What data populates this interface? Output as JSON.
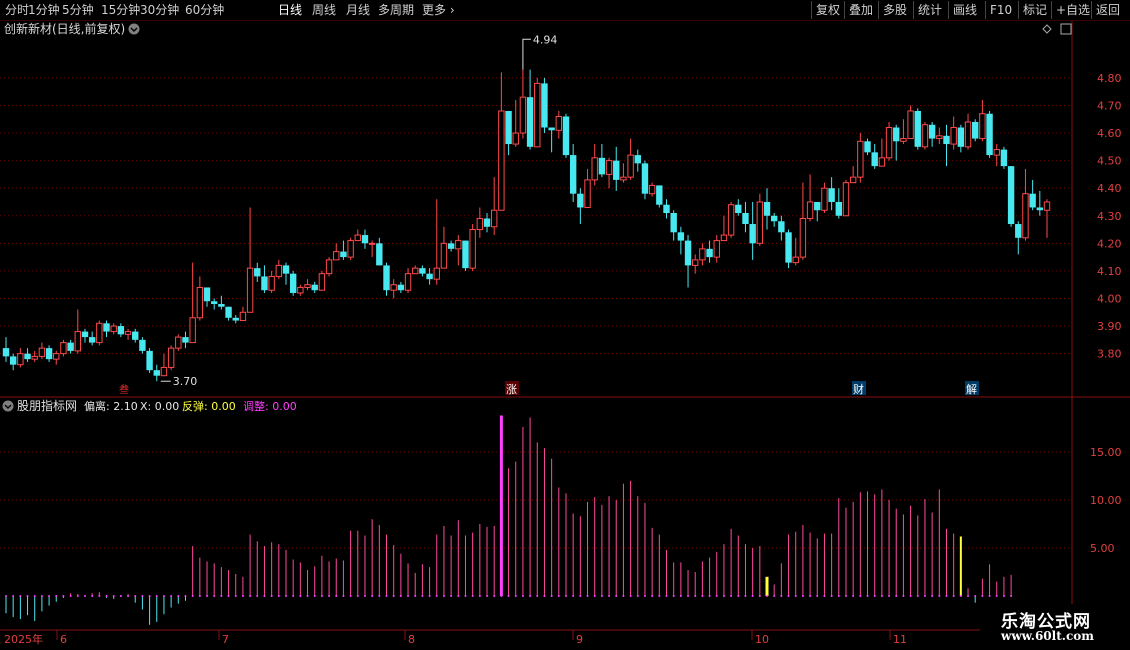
{
  "toolbar": {
    "left": [
      "分时",
      "1分钟",
      "5分钟",
      "15分钟",
      "30分钟",
      "60分钟",
      "日线",
      "周线",
      "月线",
      "多周期",
      "更多"
    ],
    "active": "日线",
    "right": [
      "复权",
      "叠加",
      "多股",
      "统计",
      "画线",
      "F10",
      "标记",
      "+自选",
      "返回"
    ]
  },
  "main": {
    "title": "创新新材(日线,前复权)",
    "price_ticks": [
      "4.80",
      "4.70",
      "4.60",
      "4.50",
      "4.40",
      "4.30",
      "4.20",
      "4.10",
      "4.00",
      "3.90",
      "3.80"
    ],
    "high_label": "4.94",
    "low_label": "3.70",
    "markers": [
      {
        "text": "叁",
        "color": "#e03030"
      },
      {
        "text": "涨",
        "color": "#e03030"
      },
      {
        "text": "财",
        "color": "#4aa8ff"
      },
      {
        "text": "解",
        "color": "#4aa8ff"
      }
    ]
  },
  "indicator": {
    "name": "股朋指标网",
    "items": [
      {
        "label": "偏离: 2.10",
        "color": "#e6e6e6"
      },
      {
        "label": "X: 0.00",
        "color": "#e6e6e6"
      },
      {
        "label": "反弹: 0.00",
        "color": "#ffff40"
      },
      {
        "label": "调整: 0.00",
        "color": "#ff40ff"
      }
    ],
    "ticks": [
      "15.00",
      "10.00",
      "5.00"
    ]
  },
  "xaxis": {
    "labels": [
      "2025年",
      "6",
      "7",
      "8",
      "9",
      "10",
      "11"
    ]
  },
  "watermark": {
    "title": "乐淘公式网",
    "url": "www.60lt.com"
  },
  "chart_data": {
    "type": "candlestick",
    "price_axis": {
      "min": 3.65,
      "max": 4.97
    },
    "candles": [
      [
        3.82,
        3.79,
        3.86,
        3.77
      ],
      [
        3.79,
        3.76,
        3.8,
        3.74
      ],
      [
        3.76,
        3.8,
        3.82,
        3.75
      ],
      [
        3.8,
        3.78,
        3.82,
        3.77
      ],
      [
        3.78,
        3.79,
        3.81,
        3.77
      ],
      [
        3.79,
        3.82,
        3.84,
        3.78
      ],
      [
        3.82,
        3.78,
        3.83,
        3.77
      ],
      [
        3.78,
        3.8,
        3.81,
        3.76
      ],
      [
        3.8,
        3.84,
        3.85,
        3.79
      ],
      [
        3.84,
        3.81,
        3.85,
        3.8
      ],
      [
        3.81,
        3.88,
        3.96,
        3.8
      ],
      [
        3.88,
        3.86,
        3.89,
        3.84
      ],
      [
        3.86,
        3.84,
        3.88,
        3.83
      ],
      [
        3.84,
        3.91,
        3.92,
        3.83
      ],
      [
        3.91,
        3.88,
        3.92,
        3.86
      ],
      [
        3.88,
        3.9,
        3.91,
        3.87
      ],
      [
        3.9,
        3.87,
        3.91,
        3.86
      ],
      [
        3.87,
        3.88,
        3.89,
        3.85
      ],
      [
        3.88,
        3.85,
        3.89,
        3.84
      ],
      [
        3.85,
        3.81,
        3.86,
        3.8
      ],
      [
        3.81,
        3.74,
        3.82,
        3.73
      ],
      [
        3.74,
        3.72,
        3.76,
        3.7
      ],
      [
        3.72,
        3.75,
        3.8,
        3.72
      ],
      [
        3.75,
        3.82,
        3.83,
        3.74
      ],
      [
        3.82,
        3.86,
        3.87,
        3.81
      ],
      [
        3.86,
        3.84,
        3.88,
        3.82
      ],
      [
        3.84,
        3.93,
        4.13,
        3.93
      ],
      [
        3.93,
        4.04,
        4.08,
        3.92
      ],
      [
        4.04,
        3.99,
        4.04,
        3.97
      ],
      [
        3.99,
        3.98,
        4.0,
        3.96
      ],
      [
        3.98,
        3.97,
        4.01,
        3.96
      ],
      [
        3.97,
        3.93,
        3.97,
        3.92
      ],
      [
        3.93,
        3.92,
        3.94,
        3.91
      ],
      [
        3.92,
        3.95,
        3.97,
        3.92
      ],
      [
        3.95,
        4.11,
        4.33,
        3.95
      ],
      [
        4.11,
        4.08,
        4.13,
        4.06
      ],
      [
        4.08,
        4.03,
        4.12,
        4.02
      ],
      [
        4.03,
        4.08,
        4.1,
        4.02
      ],
      [
        4.08,
        4.12,
        4.14,
        4.07
      ],
      [
        4.12,
        4.09,
        4.13,
        4.05
      ],
      [
        4.09,
        4.02,
        4.1,
        4.01
      ],
      [
        4.02,
        4.04,
        4.05,
        4.01
      ],
      [
        4.04,
        4.05,
        4.07,
        4.03
      ],
      [
        4.05,
        4.03,
        4.06,
        4.02
      ],
      [
        4.03,
        4.09,
        4.1,
        4.03
      ],
      [
        4.09,
        4.14,
        4.15,
        4.08
      ],
      [
        4.14,
        4.17,
        4.2,
        4.14
      ],
      [
        4.17,
        4.15,
        4.21,
        4.14
      ],
      [
        4.15,
        4.21,
        4.22,
        4.14
      ],
      [
        4.21,
        4.23,
        4.25,
        4.21
      ],
      [
        4.23,
        4.2,
        4.25,
        4.18
      ],
      [
        4.2,
        4.2,
        4.21,
        4.15
      ],
      [
        4.2,
        4.12,
        4.22,
        4.12
      ],
      [
        4.12,
        4.03,
        4.13,
        4.01
      ],
      [
        4.03,
        4.05,
        4.07,
        4.0
      ],
      [
        4.05,
        4.03,
        4.06,
        4.02
      ],
      [
        4.03,
        4.09,
        4.11,
        4.02
      ],
      [
        4.09,
        4.11,
        4.12,
        4.09
      ],
      [
        4.11,
        4.09,
        4.12,
        4.08
      ],
      [
        4.09,
        4.07,
        4.11,
        4.05
      ],
      [
        4.07,
        4.11,
        4.36,
        4.05
      ],
      [
        4.11,
        4.2,
        4.26,
        4.19
      ],
      [
        4.2,
        4.18,
        4.21,
        4.17
      ],
      [
        4.18,
        4.21,
        4.23,
        4.12
      ],
      [
        4.21,
        4.11,
        4.21,
        4.1
      ],
      [
        4.11,
        4.25,
        4.27,
        4.1
      ],
      [
        4.25,
        4.29,
        4.33,
        4.22
      ],
      [
        4.29,
        4.26,
        4.31,
        4.24
      ],
      [
        4.26,
        4.32,
        4.44,
        4.23
      ],
      [
        4.32,
        4.68,
        4.82,
        4.32
      ],
      [
        4.68,
        4.56,
        4.68,
        4.52
      ],
      [
        4.56,
        4.6,
        4.72,
        4.55
      ],
      [
        4.6,
        4.73,
        4.83,
        4.58
      ],
      [
        4.73,
        4.55,
        4.83,
        4.54
      ],
      [
        4.55,
        4.78,
        4.8,
        4.55
      ],
      [
        4.78,
        4.62,
        4.8,
        4.6
      ],
      [
        4.62,
        4.61,
        4.62,
        4.53
      ],
      [
        4.61,
        4.66,
        4.68,
        4.58
      ],
      [
        4.66,
        4.52,
        4.67,
        4.51
      ],
      [
        4.52,
        4.38,
        4.56,
        4.35
      ],
      [
        4.38,
        4.33,
        4.4,
        4.27
      ],
      [
        4.33,
        4.43,
        4.47,
        4.33
      ],
      [
        4.43,
        4.51,
        4.56,
        4.41
      ],
      [
        4.51,
        4.45,
        4.56,
        4.44
      ],
      [
        4.45,
        4.5,
        4.51,
        4.4
      ],
      [
        4.5,
        4.43,
        4.55,
        4.39
      ],
      [
        4.43,
        4.44,
        4.49,
        4.42
      ],
      [
        4.44,
        4.52,
        4.58,
        4.43
      ],
      [
        4.52,
        4.49,
        4.54,
        4.46
      ],
      [
        4.49,
        4.38,
        4.5,
        4.36
      ],
      [
        4.38,
        4.41,
        4.42,
        4.37
      ],
      [
        4.41,
        4.34,
        4.41,
        4.33
      ],
      [
        4.34,
        4.31,
        4.36,
        4.29
      ],
      [
        4.31,
        4.24,
        4.32,
        4.21
      ],
      [
        4.24,
        4.21,
        4.26,
        4.16
      ],
      [
        4.21,
        4.12,
        4.23,
        4.04
      ],
      [
        4.12,
        4.14,
        4.16,
        4.09
      ],
      [
        4.14,
        4.18,
        4.2,
        4.12
      ],
      [
        4.18,
        4.15,
        4.21,
        4.13
      ],
      [
        4.15,
        4.21,
        4.23,
        4.13
      ],
      [
        4.21,
        4.23,
        4.3,
        4.22
      ],
      [
        4.23,
        4.34,
        4.35,
        4.22
      ],
      [
        4.34,
        4.31,
        4.36,
        4.3
      ],
      [
        4.31,
        4.27,
        4.35,
        4.24
      ],
      [
        4.27,
        4.2,
        4.35,
        4.14
      ],
      [
        4.2,
        4.35,
        4.38,
        4.19
      ],
      [
        4.35,
        4.3,
        4.4,
        4.25
      ],
      [
        4.3,
        4.28,
        4.31,
        4.26
      ],
      [
        4.28,
        4.24,
        4.3,
        4.21
      ],
      [
        4.24,
        4.13,
        4.25,
        4.11
      ],
      [
        4.13,
        4.15,
        4.22,
        4.12
      ],
      [
        4.15,
        4.29,
        4.42,
        4.14
      ],
      [
        4.29,
        4.35,
        4.45,
        4.28
      ],
      [
        4.35,
        4.32,
        4.35,
        4.28
      ],
      [
        4.32,
        4.4,
        4.42,
        4.31
      ],
      [
        4.4,
        4.35,
        4.44,
        4.32
      ],
      [
        4.35,
        4.3,
        4.4,
        4.29
      ],
      [
        4.3,
        4.42,
        4.43,
        4.35
      ],
      [
        4.42,
        4.44,
        4.48,
        4.43
      ],
      [
        4.44,
        4.57,
        4.6,
        4.42
      ],
      [
        4.57,
        4.53,
        4.58,
        4.52
      ],
      [
        4.53,
        4.48,
        4.56,
        4.47
      ],
      [
        4.48,
        4.51,
        4.58,
        4.48
      ],
      [
        4.51,
        4.62,
        4.64,
        4.5
      ],
      [
        4.62,
        4.57,
        4.63,
        4.5
      ],
      [
        4.57,
        4.58,
        4.65,
        4.56
      ],
      [
        4.58,
        4.68,
        4.7,
        4.58
      ],
      [
        4.68,
        4.55,
        4.69,
        4.54
      ],
      [
        4.55,
        4.63,
        4.64,
        4.54
      ],
      [
        4.63,
        4.58,
        4.64,
        4.55
      ],
      [
        4.58,
        4.59,
        4.62,
        4.56
      ],
      [
        4.59,
        4.56,
        4.63,
        4.48
      ],
      [
        4.56,
        4.62,
        4.66,
        4.54
      ],
      [
        4.62,
        4.55,
        4.63,
        4.53
      ],
      [
        4.55,
        4.64,
        4.67,
        4.54
      ],
      [
        4.64,
        4.58,
        4.65,
        4.57
      ],
      [
        4.58,
        4.67,
        4.72,
        4.57
      ],
      [
        4.67,
        4.52,
        4.68,
        4.51
      ],
      [
        4.52,
        4.54,
        4.56,
        4.48
      ],
      [
        4.54,
        4.48,
        4.55,
        4.47
      ],
      [
        4.48,
        4.27,
        4.48,
        4.26
      ],
      [
        4.27,
        4.22,
        4.28,
        4.16
      ],
      [
        4.22,
        4.38,
        4.47,
        4.21
      ],
      [
        4.38,
        4.33,
        4.43,
        4.32
      ],
      [
        4.33,
        4.32,
        4.39,
        4.3
      ],
      [
        4.32,
        4.35,
        4.36,
        4.22
      ]
    ],
    "indicator_axis": {
      "min": -3,
      "max": 19
    },
    "indicator_values": [
      -1.8,
      -2.2,
      -2.4,
      -2.0,
      -2.6,
      -1.6,
      -1.0,
      -0.6,
      -0.2,
      0.3,
      0.2,
      -0.1,
      0.3,
      0.4,
      -0.2,
      -0.3,
      -0.1,
      0.2,
      -0.7,
      -1.4,
      -3.0,
      -2.7,
      -1.9,
      -1.2,
      -0.8,
      -0.5,
      5.2,
      4.0,
      3.6,
      3.4,
      3.0,
      2.7,
      2.3,
      2.0,
      6.4,
      5.7,
      5.2,
      5.6,
      5.4,
      4.8,
      3.8,
      3.5,
      2.7,
      3.1,
      4.2,
      3.6,
      3.9,
      3.7,
      6.8,
      6.8,
      6.3,
      8.0,
      7.4,
      6.4,
      5.3,
      4.4,
      3.4,
      2.4,
      3.3,
      3.0,
      6.4,
      7.3,
      6.3,
      7.9,
      6.3,
      6.6,
      7.5,
      7.2,
      7.3,
      18.8,
      13.3,
      14.0,
      17.6,
      18.6,
      16.0,
      15.4,
      14.3,
      11.3,
      10.7,
      8.6,
      8.3,
      9.8,
      10.3,
      9.5,
      10.4,
      10.0,
      11.7,
      12.0,
      10.4,
      9.7,
      7.1,
      6.4,
      4.8,
      3.5,
      3.5,
      2.7,
      2.5,
      3.6,
      4.0,
      4.6,
      5.4,
      7.0,
      6.3,
      5.4,
      5.0,
      5.2,
      2.0,
      1.2,
      3.4,
      6.4,
      6.7,
      7.4,
      6.6,
      6.0,
      6.5,
      6.5,
      10.2,
      9.2,
      9.8,
      10.8,
      10.9,
      10.6,
      11.1,
      10.0,
      9.1,
      8.5,
      9.4,
      8.4,
      10.1,
      8.7,
      11.1,
      7.0,
      6.5,
      6.2,
      0.8,
      -0.7,
      1.8,
      3.3,
      1.5,
      2.0,
      2.2
    ],
    "indicator_colors": {
      "up": "#ff4aa0",
      "down": "#4fe6f0",
      "yellow": "#ffff40",
      "magenta": "#ff40ff"
    }
  }
}
